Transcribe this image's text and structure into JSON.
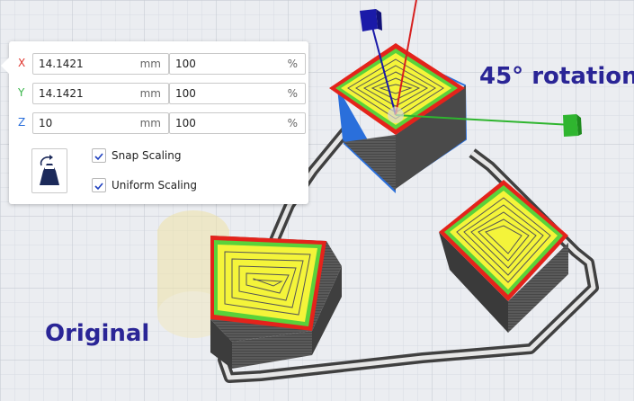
{
  "scale_panel": {
    "rows": [
      {
        "axis": "X",
        "axis_color": "#e0332b",
        "value": "14.1421",
        "unit": "mm",
        "percent": "100",
        "percent_unit": "%"
      },
      {
        "axis": "Y",
        "axis_color": "#39b54a",
        "value": "14.1421",
        "unit": "mm",
        "percent": "100",
        "percent_unit": "%"
      },
      {
        "axis": "Z",
        "axis_color": "#2a6fdb",
        "value": "10",
        "unit": "mm",
        "percent": "100",
        "percent_unit": "%"
      }
    ],
    "lock_icon": "scale-to-bed-icon",
    "snap_scaling": {
      "label": "Snap Scaling",
      "checked": true
    },
    "uniform_scaling": {
      "label": "Uniform Scaling",
      "checked": true
    }
  },
  "annotations": {
    "rotation": "45° rotation",
    "original": "Original"
  },
  "colors": {
    "accent": "#1d3fbf",
    "annotation_text": "#2a2596",
    "cube_top_fill": "#f4f43a",
    "cube_outer_wall": "#e4231b",
    "cube_inner_wall": "#5ad23a",
    "gizmo_blue": "#1a1aa8",
    "gizmo_green": "#2fb52f",
    "gizmo_red": "#d62020",
    "skirt": "#4a4a4a",
    "build_plate": "#ebedf1"
  }
}
